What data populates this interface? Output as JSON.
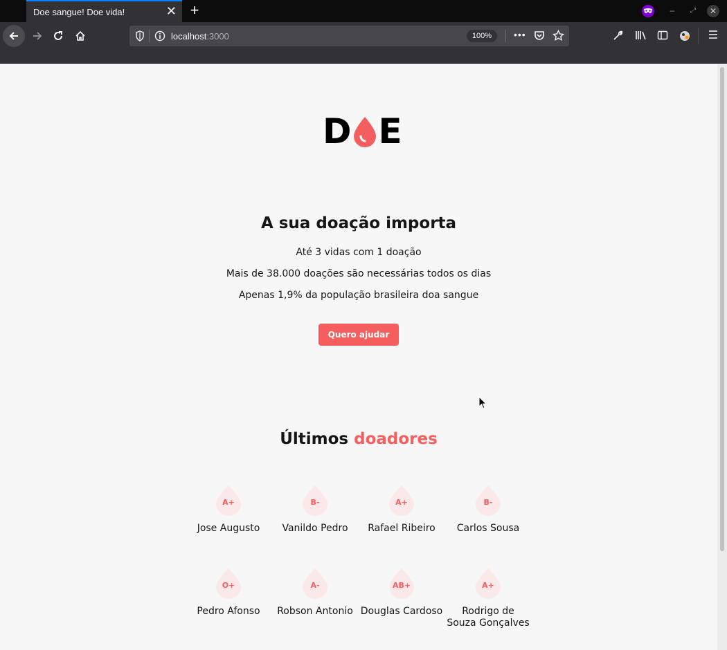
{
  "browser": {
    "tab_title": "Doe sangue! Doe vida!",
    "url_host": "localhost",
    "url_port": ":3000",
    "zoom": "100%"
  },
  "page": {
    "logo_left": "D",
    "logo_right": "E",
    "hero": {
      "title": "A sua doação importa",
      "lines": [
        "Até 3 vidas com 1 doação",
        "Mais de 38.000 doações são necessárias todos os dias",
        "Apenas 1,9% da população brasileira doa sangue"
      ],
      "button_label": "Quero ajudar"
    },
    "donors_section": {
      "title_part1": "Últimos ",
      "title_part2": "doadores"
    },
    "donors": [
      {
        "blood": "A+",
        "name": "Jose Augusto"
      },
      {
        "blood": "B-",
        "name": "Vanildo Pedro"
      },
      {
        "blood": "A+",
        "name": "Rafael Ribeiro"
      },
      {
        "blood": "B-",
        "name": "Carlos Sousa"
      },
      {
        "blood": "O+",
        "name": "Pedro Afonso"
      },
      {
        "blood": "A-",
        "name": "Robson Antonio"
      },
      {
        "blood": "AB+",
        "name": "Douglas Cardoso"
      },
      {
        "blood": "A+",
        "name": "Rodrigo de Souza Gonçalves"
      }
    ],
    "colors": {
      "accent": "#f55e5e",
      "badge_bg": "#fbe9e9",
      "page_bg": "#f7f7f7",
      "text": "#151515"
    }
  }
}
